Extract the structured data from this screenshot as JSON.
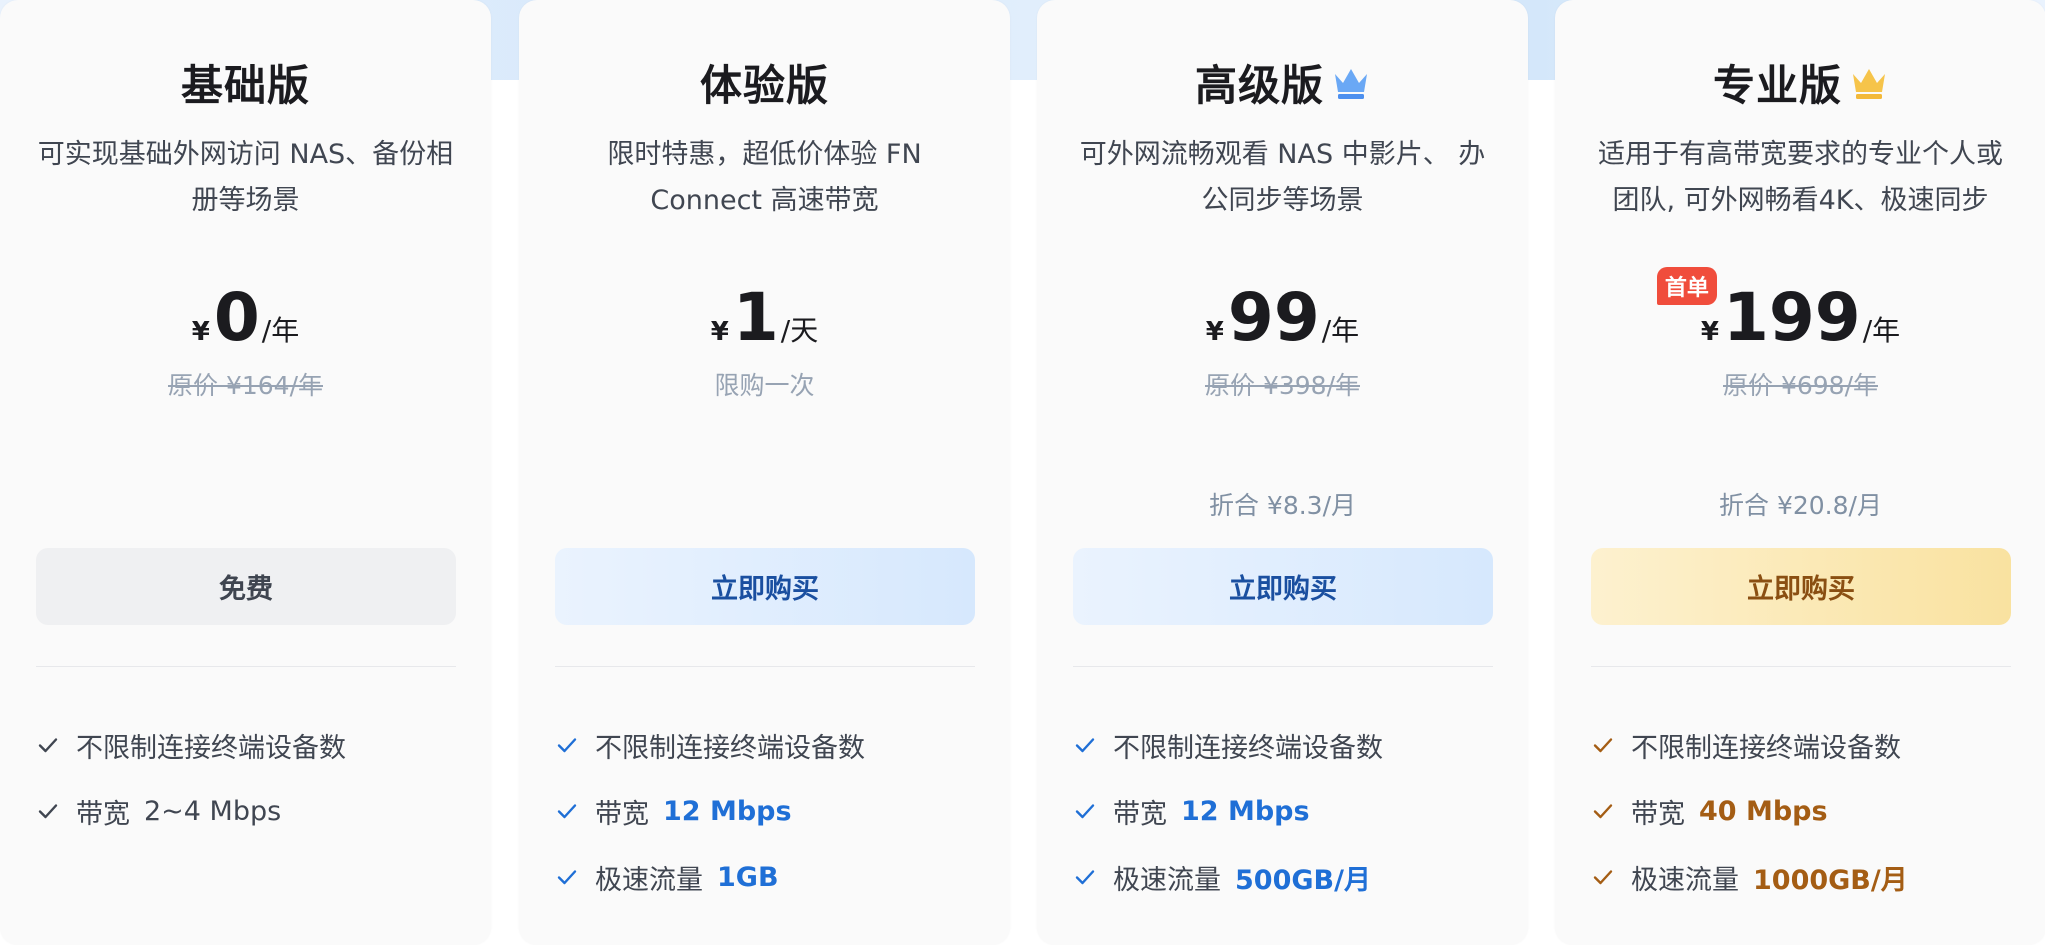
{
  "colors": {
    "blue_accent": "#1f6fd6",
    "gold_accent": "#a45d14",
    "badge_red": "#f04d3c",
    "muted_text": "#97a3b3"
  },
  "plans": [
    {
      "title": "基础版",
      "crown": null,
      "desc": "可实现基础外网访问 NAS、备份相册等场景",
      "currency": "¥",
      "amount": "0",
      "unit": "/年",
      "badge": null,
      "sub": "原价 ¥164/年",
      "sub_strike": true,
      "monthly": null,
      "button_label": "免费",
      "button_style": "gray",
      "features": [
        {
          "label": "不限制连接终端设备数"
        },
        {
          "label": "带宽",
          "value": "2~4 Mbps",
          "highlight": false
        }
      ],
      "check_color": "#404651"
    },
    {
      "title": "体验版",
      "crown": null,
      "desc": "限时特惠，超低价体验 FN Connect 高速带宽",
      "currency": "¥",
      "amount": "1",
      "unit": "/天",
      "badge": null,
      "sub": "限购一次",
      "sub_strike": false,
      "monthly": null,
      "button_label": "立即购买",
      "button_style": "blue",
      "features": [
        {
          "label": "不限制连接终端设备数"
        },
        {
          "label": "带宽",
          "value": "12 Mbps",
          "highlight": "blue"
        },
        {
          "label": "极速流量",
          "value": "1GB",
          "highlight": "blue"
        }
      ],
      "check_color": "#1f6fd6"
    },
    {
      "title": "高级版",
      "crown": "blue-crown-icon",
      "desc": "可外网流畅观看 NAS 中影片、 办公同步等场景",
      "currency": "¥",
      "amount": "99",
      "unit": "/年",
      "badge": null,
      "sub": "原价 ¥398/年",
      "sub_strike": true,
      "monthly": "折合 ¥8.3/月",
      "button_label": "立即购买",
      "button_style": "blue",
      "features": [
        {
          "label": "不限制连接终端设备数"
        },
        {
          "label": "带宽",
          "value": "12 Mbps",
          "highlight": "blue"
        },
        {
          "label": "极速流量",
          "value": "500GB/月",
          "highlight": "blue"
        }
      ],
      "check_color": "#1f6fd6"
    },
    {
      "title": "专业版",
      "crown": "gold-crown-icon",
      "desc": "适用于有高带宽要求的专业个人或团队, 可外网畅看4K、极速同步",
      "currency": "¥",
      "amount": "199",
      "unit": "/年",
      "badge": "首单",
      "sub": "原价 ¥698/年",
      "sub_strike": true,
      "monthly": "折合 ¥20.8/月",
      "button_label": "立即购买",
      "button_style": "gold",
      "features": [
        {
          "label": "不限制连接终端设备数"
        },
        {
          "label": "带宽",
          "value": "40 Mbps",
          "highlight": "gold"
        },
        {
          "label": "极速流量",
          "value": "1000GB/月",
          "highlight": "gold"
        }
      ],
      "check_color": "#a45d14"
    }
  ]
}
